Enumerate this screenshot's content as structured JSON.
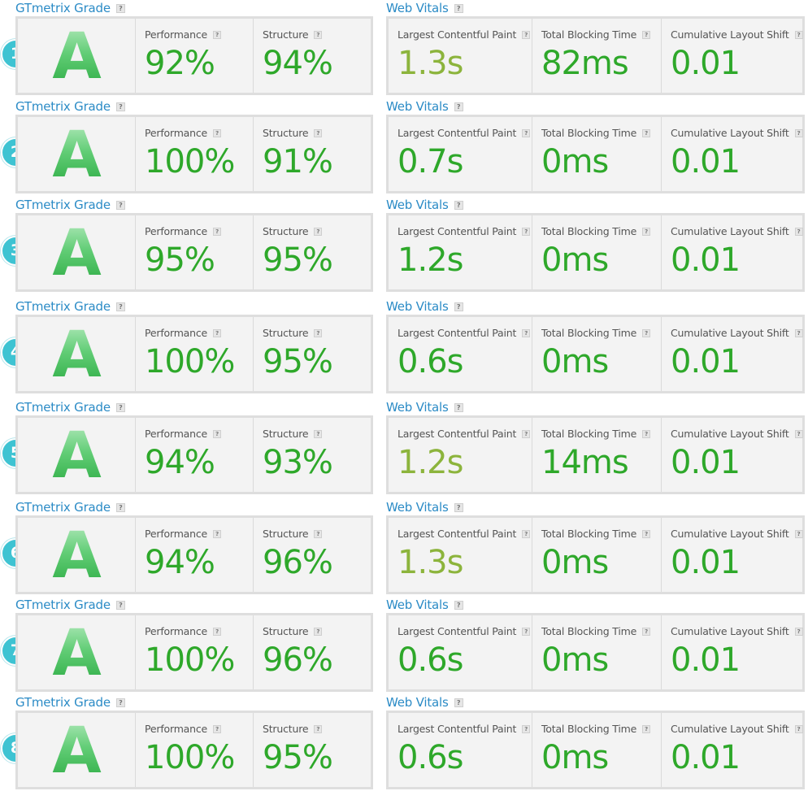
{
  "header_grade": "GTmetrix Grade",
  "header_vitals": "Web Vitals",
  "help_glyph": "?",
  "labels": {
    "performance": "Performance",
    "structure": "Structure",
    "lcp": "Largest Contentful Paint",
    "tbt": "Total Blocking Time",
    "cls": "Cumulative Layout Shift"
  },
  "colors": {
    "good": "#2ea82a",
    "ok": "#8cb43c",
    "link": "#2b8bc6",
    "badge": "#3ec3d2"
  },
  "results": [
    {
      "number": "1",
      "grade": "A",
      "performance": "92%",
      "structure": "94%",
      "lcp": "1.3s",
      "lcp_status": "ok",
      "tbt": "82ms",
      "cls": "0.01"
    },
    {
      "number": "2",
      "grade": "A",
      "performance": "100%",
      "structure": "91%",
      "lcp": "0.7s",
      "lcp_status": "good",
      "tbt": "0ms",
      "cls": "0.01"
    },
    {
      "number": "3",
      "grade": "A",
      "performance": "95%",
      "structure": "95%",
      "lcp": "1.2s",
      "lcp_status": "good",
      "tbt": "0ms",
      "cls": "0.01"
    },
    {
      "number": "4",
      "grade": "A",
      "performance": "100%",
      "structure": "95%",
      "lcp": "0.6s",
      "lcp_status": "good",
      "tbt": "0ms",
      "cls": "0.01"
    },
    {
      "number": "5",
      "grade": "A",
      "performance": "94%",
      "structure": "93%",
      "lcp": "1.2s",
      "lcp_status": "ok",
      "tbt": "14ms",
      "cls": "0.01"
    },
    {
      "number": "6",
      "grade": "A",
      "performance": "94%",
      "structure": "96%",
      "lcp": "1.3s",
      "lcp_status": "ok",
      "tbt": "0ms",
      "cls": "0.01"
    },
    {
      "number": "7",
      "grade": "A",
      "performance": "100%",
      "structure": "96%",
      "lcp": "0.6s",
      "lcp_status": "good",
      "tbt": "0ms",
      "cls": "0.01"
    },
    {
      "number": "8",
      "grade": "A",
      "performance": "100%",
      "structure": "95%",
      "lcp": "0.6s",
      "lcp_status": "good",
      "tbt": "0ms",
      "cls": "0.01"
    }
  ]
}
